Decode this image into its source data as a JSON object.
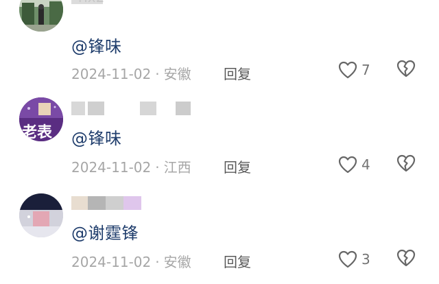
{
  "comments": [
    {
      "mention": "@锋味",
      "date": "2024-11-02",
      "separator": "·",
      "location": "安徽",
      "reply_label": "回复",
      "like_count": "7",
      "name_partial": "rix2"
    },
    {
      "mention": "@锋味",
      "date": "2024-11-02",
      "separator": "·",
      "location": "江西",
      "reply_label": "回复",
      "like_count": "4",
      "avatar_text": "老表"
    },
    {
      "mention": "@谢霆锋",
      "date": "2024-11-02",
      "separator": "·",
      "location": "安徽",
      "reply_label": "回复",
      "like_count": "3"
    }
  ],
  "icons": {
    "like": "heart-outline-icon",
    "dislike": "broken-heart-icon"
  },
  "colors": {
    "mention": "#1f3d6c",
    "meta": "#a6a6a6",
    "reply": "#595959",
    "icon": "#666666"
  }
}
